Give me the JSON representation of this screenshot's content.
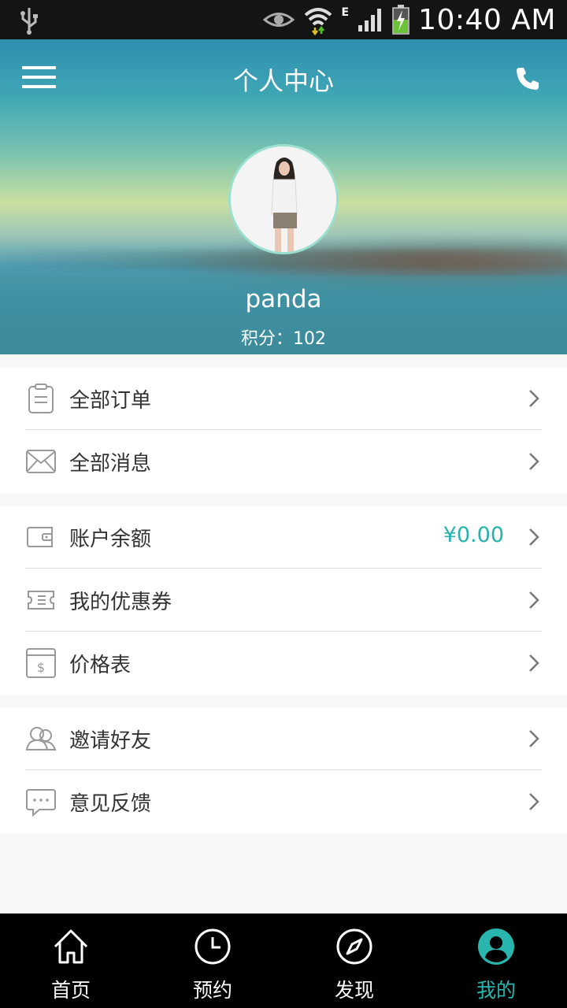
{
  "status_bar": {
    "time": "10:40 AM",
    "network": "E"
  },
  "header": {
    "title": "个人中心",
    "username": "panda",
    "points": "积分：102"
  },
  "groups": [
    {
      "items": [
        {
          "label": "全部订单",
          "icon": "clipboard-icon"
        },
        {
          "label": "全部消息",
          "icon": "envelope-icon"
        }
      ]
    },
    {
      "items": [
        {
          "label": "账户余额",
          "icon": "wallet-icon",
          "value": "¥0.00"
        },
        {
          "label": "我的优惠券",
          "icon": "coupon-icon"
        },
        {
          "label": "价格表",
          "icon": "price-list-icon"
        }
      ]
    },
    {
      "items": [
        {
          "label": "邀请好友",
          "icon": "friends-icon"
        },
        {
          "label": "意见反馈",
          "icon": "chat-bubble-icon"
        }
      ]
    }
  ],
  "tabs": [
    {
      "label": "首页",
      "icon": "home-icon"
    },
    {
      "label": "预约",
      "icon": "clock-icon"
    },
    {
      "label": "发现",
      "icon": "compass-icon"
    },
    {
      "label": "我的",
      "icon": "user-icon",
      "active": true
    }
  ],
  "colors": {
    "accent": "#27b5ae",
    "tabbar": "#000000",
    "status_bar": "#141414"
  }
}
